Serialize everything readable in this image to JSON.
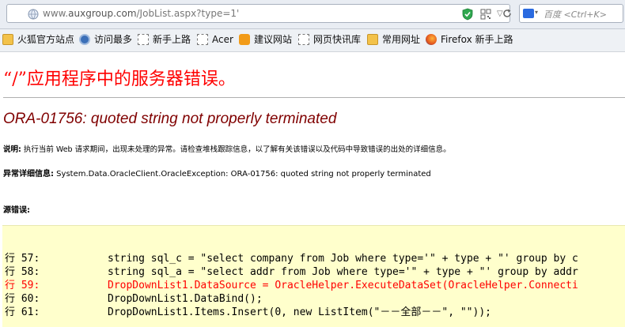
{
  "toolbar": {
    "url_prefix": "www.",
    "url_host": "auxgroup.com",
    "url_path": "/JobList.aspx?type=1'",
    "search_placeholder": "百度 <Ctrl+K>"
  },
  "bookmarks": [
    {
      "label": "火狐官方站点",
      "icon": "firefox-icon"
    },
    {
      "label": "访问最多",
      "icon": "gear-icon"
    },
    {
      "label": "新手上路",
      "icon": "page-icon"
    },
    {
      "label": "Acer",
      "icon": "page-icon"
    },
    {
      "label": "建议网站",
      "icon": "bulb-icon"
    },
    {
      "label": "网页快讯库",
      "icon": "page-icon"
    },
    {
      "label": "常用网址",
      "icon": "folder-icon"
    },
    {
      "label": "Firefox 新手上路",
      "icon": "firefox-icon"
    }
  ],
  "page": {
    "app_title": "“/”应用程序中的服务器错误。",
    "error_heading": "ORA-01756: quoted string not properly terminated",
    "description_label": "说明:",
    "description_text": " 执行当前 Web 请求期间，出现未处理的异常。请检查堆栈跟踪信息，以了解有关该错误以及代码中导致错误的出处的详细信息。",
    "exception_label": "异常详细信息:",
    "exception_text": " System.Data.OracleClient.OracleException: ORA-01756: quoted string not properly terminated",
    "source_label": "源错误:",
    "source_lines": [
      {
        "ln": "行 57:",
        "code": "string sql_c = \"select company from Job where type='\" + type + \"' group by c"
      },
      {
        "ln": "行 58:",
        "code": "string sql_a = \"select addr from Job where type='\" + type + \"' group by addr"
      },
      {
        "ln": "行 59:",
        "code": "DropDownList1.DataSource = OracleHelper.ExecuteDataSet(OracleHelper.Connecti"
      },
      {
        "ln": "行 60:",
        "code": "DropDownList1.DataBind();"
      },
      {
        "ln": "行 61:",
        "code": "DropDownList1.Items.Insert(0, new ListItem(\"－－全部－－\", \"\"));"
      }
    ]
  },
  "colors": {
    "app_title": "#ff0000",
    "error_heading": "#800000",
    "code_background": "#ffffcc",
    "error_line": "#ff0000"
  }
}
